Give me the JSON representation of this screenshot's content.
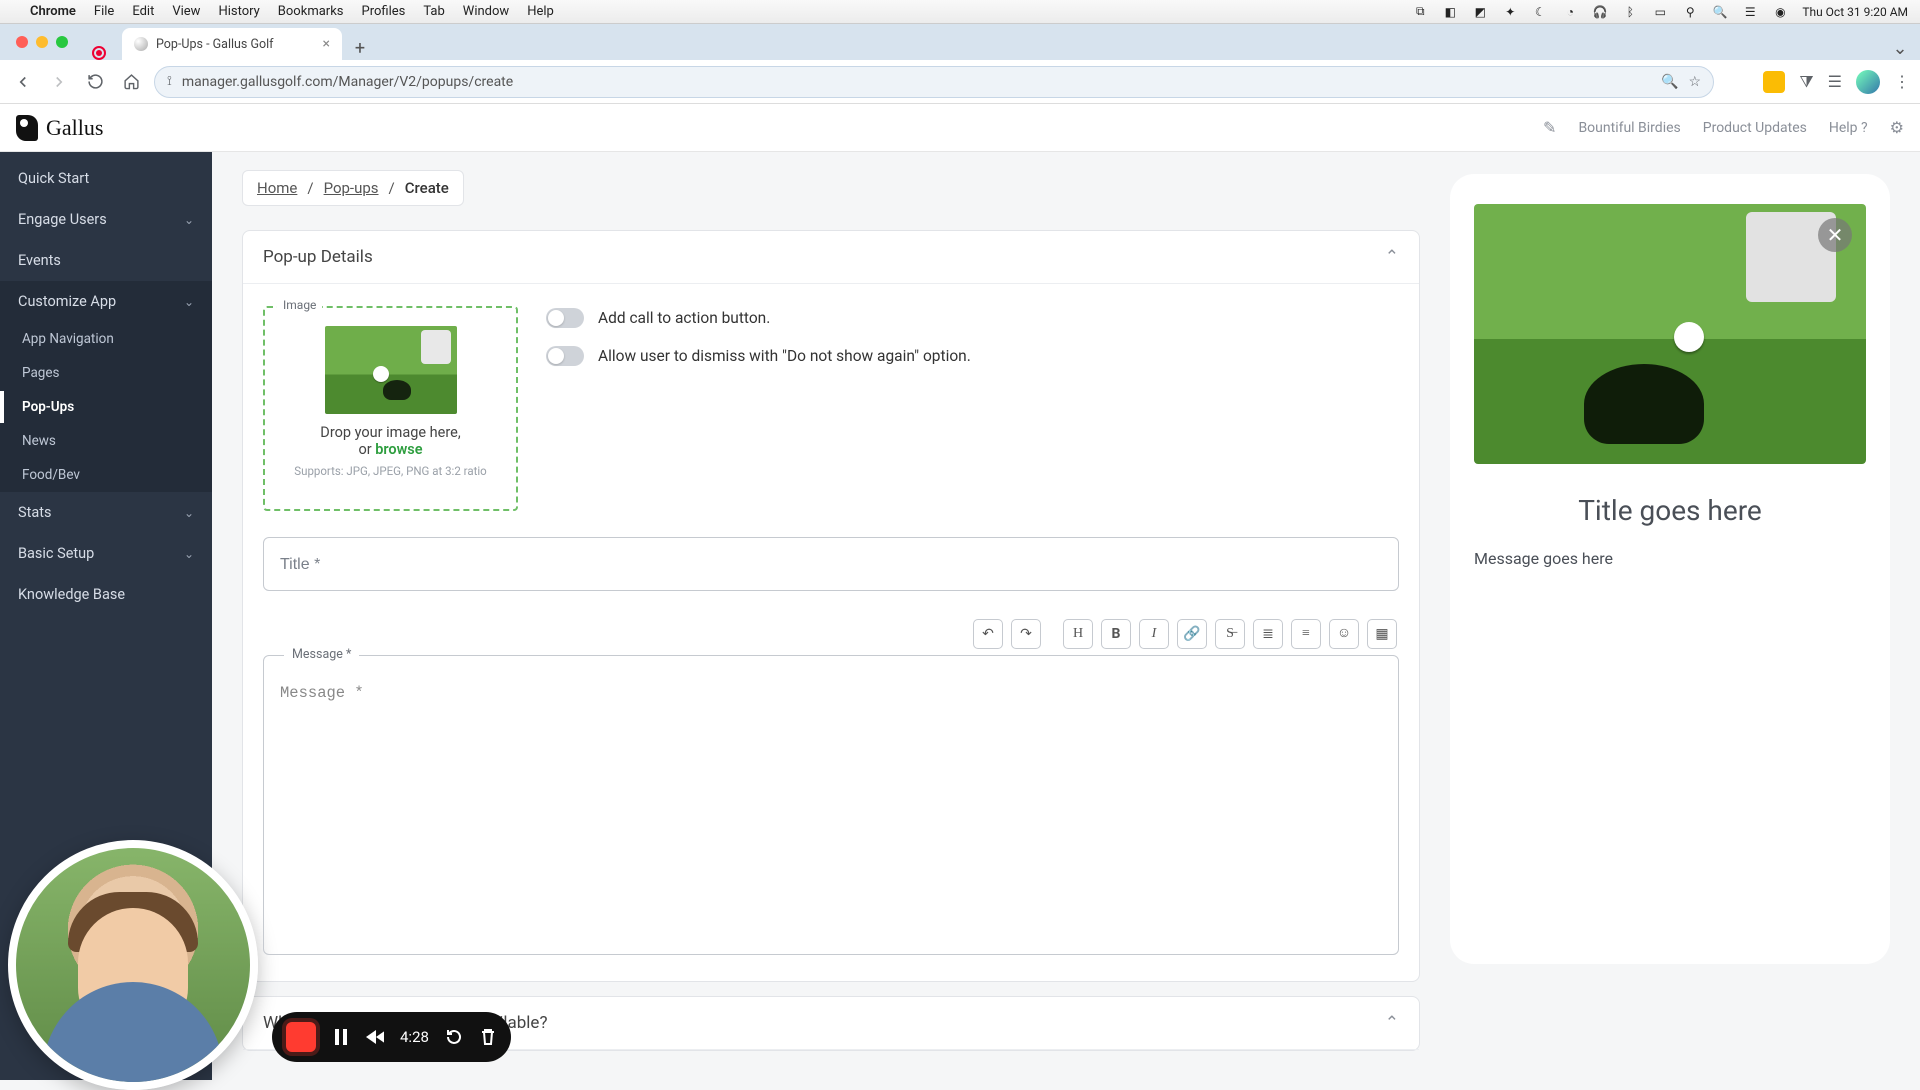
{
  "mac": {
    "app": "Chrome",
    "menus": [
      "File",
      "Edit",
      "View",
      "History",
      "Bookmarks",
      "Profiles",
      "Tab",
      "Window",
      "Help"
    ],
    "clock": "Thu Oct 31  9:20 AM"
  },
  "browser": {
    "tab_title": "Pop-Ups - Gallus Golf",
    "url": "manager.gallusgolf.com/Manager/V2/popups/create"
  },
  "header": {
    "brand": "Gallus",
    "links": {
      "org": "Bountiful Birdies",
      "updates": "Product Updates",
      "help": "Help"
    }
  },
  "sidebar": {
    "items": [
      {
        "label": "Quick Start",
        "expandable": false
      },
      {
        "label": "Engage Users",
        "expandable": true
      },
      {
        "label": "Events",
        "expandable": false
      },
      {
        "label": "Customize App",
        "expandable": true,
        "open": true,
        "children": [
          {
            "label": "App Navigation"
          },
          {
            "label": "Pages"
          },
          {
            "label": "Pop-Ups",
            "active": true
          },
          {
            "label": "News"
          },
          {
            "label": "Food/Bev"
          }
        ]
      },
      {
        "label": "Stats",
        "expandable": true
      },
      {
        "label": "Basic Setup",
        "expandable": true
      },
      {
        "label": "Knowledge Base",
        "expandable": false
      }
    ]
  },
  "breadcrumb": {
    "home": "Home",
    "parent": "Pop-ups",
    "current": "Create"
  },
  "card": {
    "title": "Pop-up Details",
    "next_title": "When should the pop-up be available?",
    "image_legend": "Image",
    "drop_line1": "Drop your image here,",
    "drop_line2_prefix": "or ",
    "drop_browse": "browse",
    "drop_support": "Supports: JPG, JPEG, PNG at 3:2 ratio",
    "toggle_cta": "Add call to action button.",
    "toggle_dismiss": "Allow user to dismiss with \"Do not show again\" option.",
    "title_placeholder": "Title *",
    "message_legend": "Message *",
    "message_placeholder": "Message *"
  },
  "editor_buttons": [
    "undo",
    "redo",
    "heading",
    "bold",
    "italic",
    "link",
    "strike",
    "ul",
    "ol",
    "emoji",
    "image"
  ],
  "preview": {
    "title": "Title goes here",
    "message": "Message goes here"
  },
  "recorder": {
    "time": "4:28"
  }
}
